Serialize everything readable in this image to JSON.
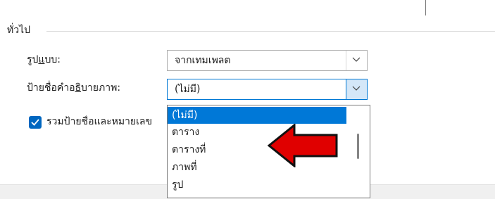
{
  "group": {
    "title": "ทั่วไป"
  },
  "format": {
    "label_pre": "รูป",
    "label_ul": "แ",
    "label_post": "บบ:",
    "value": "จากเทมเพลต"
  },
  "caption": {
    "label_pre": "ป้ายชื่อคำอ",
    "label_ul": "ธิ",
    "label_post": "บายภาพ:",
    "value": "(ไม่มี)"
  },
  "include_labels": {
    "checked": true,
    "label": "รวมป้ายชื่อและหมายเลข"
  },
  "dropdown": {
    "options": [
      "(ไม่มี)",
      "ตาราง",
      "ตารางที่",
      "ภาพที่",
      "รูป"
    ],
    "selected_index": 0
  },
  "colors": {
    "accent": "#0078d7",
    "annotation_arrow": "#e00000"
  },
  "icons": {
    "combo_arrow": "chevron-down-icon",
    "checkbox": "checkmark-icon",
    "annotation": "red-left-arrow-icon"
  }
}
